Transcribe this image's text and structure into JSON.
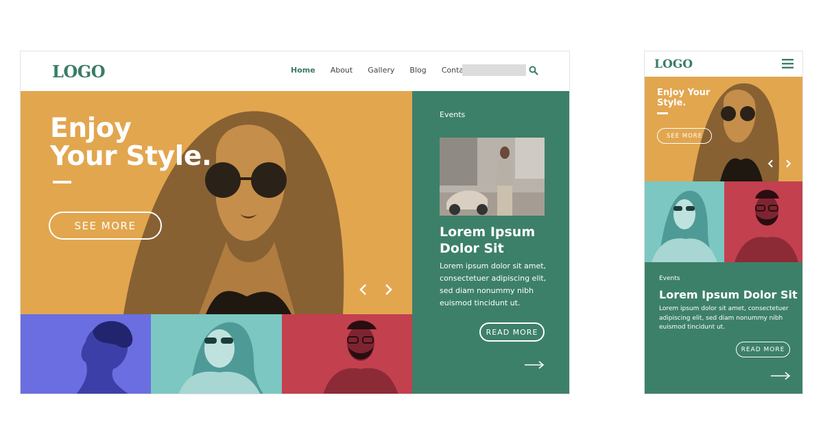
{
  "desktop": {
    "logo": "LOGO",
    "nav": [
      {
        "label": "Home",
        "active": true
      },
      {
        "label": "About",
        "active": false
      },
      {
        "label": "Gallery",
        "active": false
      },
      {
        "label": "Blog",
        "active": false
      },
      {
        "label": "Contact",
        "active": false
      }
    ],
    "search": {
      "value": "",
      "icon": "search-icon"
    },
    "hero": {
      "title_line1": "Enjoy",
      "title_line2": "Your Style.",
      "button": "SEE MORE"
    },
    "events": {
      "label": "Events",
      "title": "Lorem Ipsum Dolor Sit",
      "body": "Lorem ipsum dolor sit amet, consectetuer adipiscing elit, sed diam nonummy nibh euismod tincidunt ut.",
      "button": "READ MORE"
    }
  },
  "mobile": {
    "logo": "LOGO",
    "hero": {
      "title_line1": "Enjoy Your",
      "title_line2": "Style.",
      "button": "SEE MORE"
    },
    "events": {
      "label": "Events",
      "title": "Lorem Ipsum Dolor Sit",
      "body": "Lorem ipsum dolor sit amet, consectetuer adipiscing elit, sed diam nonummy nibh euismod tincidunt ut.",
      "button": "READ MORE"
    }
  },
  "colors": {
    "brand": "#3a7c68",
    "hero": "#e2a64f",
    "events": "#3d8069",
    "tile_purple": "#6b6ee0",
    "tile_teal": "#7cc7c2",
    "tile_red": "#c3404f"
  }
}
